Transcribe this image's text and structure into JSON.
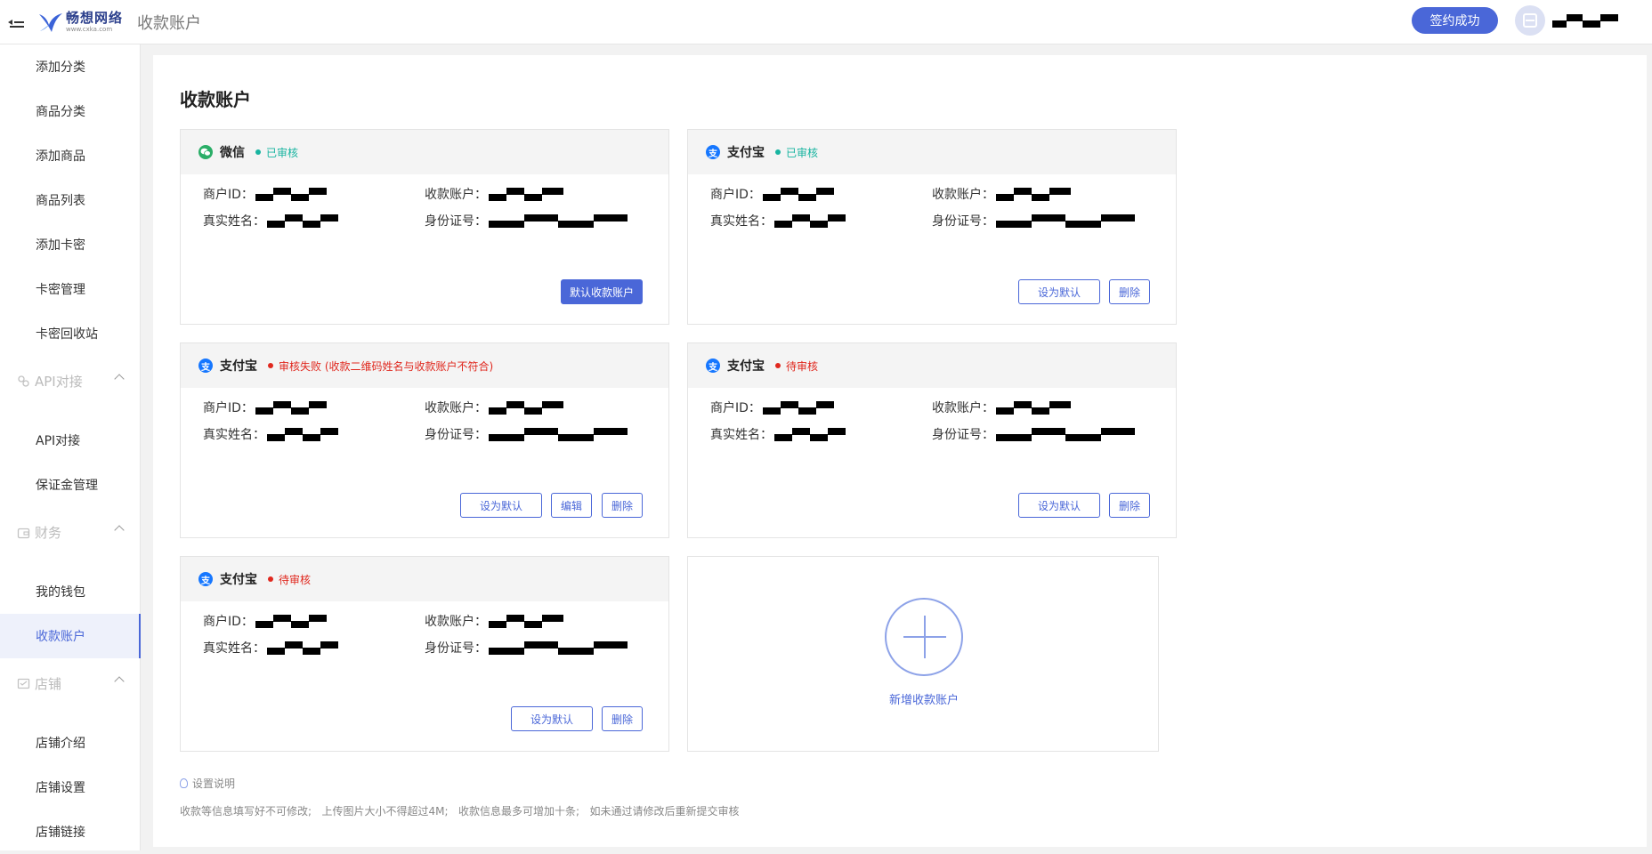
{
  "header": {
    "logo_name": "畅想网络",
    "logo_url": "www.cxka.com",
    "page_title": "收款账户",
    "sign_button": "签约成功"
  },
  "sidebar": {
    "items": [
      {
        "label": "添加分类"
      },
      {
        "label": "商品分类"
      },
      {
        "label": "添加商品"
      },
      {
        "label": "商品列表"
      },
      {
        "label": "添加卡密"
      },
      {
        "label": "卡密管理"
      },
      {
        "label": "卡密回收站"
      }
    ],
    "groups": [
      {
        "label": "API对接",
        "icon": "api-icon",
        "items": [
          {
            "label": "API对接"
          },
          {
            "label": "保证金管理"
          }
        ]
      },
      {
        "label": "财务",
        "icon": "wallet-icon",
        "items": [
          {
            "label": "我的钱包"
          },
          {
            "label": "收款账户"
          }
        ]
      },
      {
        "label": "店铺",
        "icon": "shop-icon",
        "items": [
          {
            "label": "店铺介绍"
          },
          {
            "label": "店铺设置"
          },
          {
            "label": "店铺链接"
          }
        ]
      }
    ],
    "active_item": "收款账户"
  },
  "main": {
    "title": "收款账户",
    "labels": {
      "merchant_id": "商户ID：",
      "account": "收款账户：",
      "real_name": "真实姓名：",
      "id_number": "身份证号："
    },
    "cards": [
      {
        "brand": "微信",
        "icon": "wechat-icon",
        "status": "已审核",
        "status_type": "ok",
        "buttons": [
          "默认收款账户"
        ]
      },
      {
        "brand": "支付宝",
        "icon": "alipay-icon",
        "status": "已审核",
        "status_type": "ok",
        "buttons": [
          "设为默认",
          "删除"
        ]
      },
      {
        "brand": "支付宝",
        "icon": "alipay-icon",
        "status": "审核失败 (收款二维码姓名与收款账户不符合)",
        "status_type": "bad",
        "buttons": [
          "设为默认",
          "编辑",
          "删除"
        ]
      },
      {
        "brand": "支付宝",
        "icon": "alipay-icon",
        "status": "待审核",
        "status_type": "bad",
        "buttons": [
          "设为默认",
          "删除"
        ]
      },
      {
        "brand": "支付宝",
        "icon": "alipay-icon",
        "status": "待审核",
        "status_type": "bad",
        "buttons": [
          "设为默认",
          "删除"
        ]
      }
    ],
    "add_card_label": "新增收款账户",
    "note_title": "设置说明",
    "note_text": "收款等信息填写好不可修改;   上传图片大小不得超过4M;   收款信息最多可增加十条;   如未通过请修改后重新提交审核"
  },
  "colors": {
    "accent": "#4a67d8",
    "ok": "#18b4a0",
    "bad": "#e0281e",
    "wechat": "#2aae67",
    "alipay": "#1677ff"
  }
}
